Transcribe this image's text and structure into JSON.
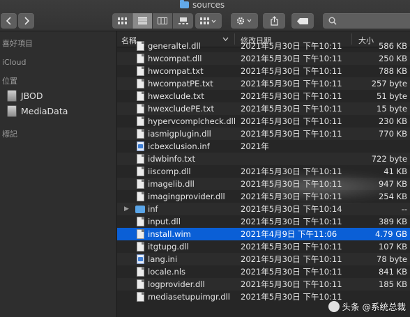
{
  "window": {
    "title": "sources"
  },
  "toolbar": {
    "back_icon": "chevron-left-icon",
    "forward_icon": "chevron-right-icon",
    "view_modes": [
      "icon-view",
      "list-view",
      "column-view",
      "gallery-view"
    ],
    "active_view": "list-view"
  },
  "sidebar": {
    "favorites_header": "喜好項目",
    "icloud_header": "iCloud",
    "locations_header": "位置",
    "devices": [
      {
        "label": "JBOD"
      },
      {
        "label": "MediaData"
      }
    ],
    "tags_header": "標記"
  },
  "columns": {
    "name": "名稱",
    "date": "修改日期",
    "size": "大小"
  },
  "files": [
    {
      "name": "generaltel.dll",
      "date": "2021年5月30日 下午10:11",
      "size": "586 KB",
      "kind": "doc"
    },
    {
      "name": "hwcompat.dll",
      "date": "2021年5月30日 下午10:11",
      "size": "250 KB",
      "kind": "doc"
    },
    {
      "name": "hwcompat.txt",
      "date": "2021年5月30日 下午10:11",
      "size": "788 KB",
      "kind": "doc"
    },
    {
      "name": "hwcompatPE.txt",
      "date": "2021年5月30日 下午10:11",
      "size": "257 byte",
      "kind": "doc"
    },
    {
      "name": "hwexclude.txt",
      "date": "2021年5月30日 下午10:11",
      "size": "51 byte",
      "kind": "doc"
    },
    {
      "name": "hwexcludePE.txt",
      "date": "2021年5月30日 下午10:11",
      "size": "15 byte",
      "kind": "doc"
    },
    {
      "name": "hypervcomplcheck.dll",
      "date": "2021年5月30日 下午10:11",
      "size": "230 KB",
      "kind": "doc"
    },
    {
      "name": "iasmigplugin.dll",
      "date": "2021年5月30日 下午10:11",
      "size": "770 KB",
      "kind": "doc"
    },
    {
      "name": "icbexclusion.inf",
      "date": "2021年",
      "size": "",
      "kind": "inf"
    },
    {
      "name": "idwbinfo.txt",
      "date": "",
      "size": "722 byte",
      "kind": "doc"
    },
    {
      "name": "iiscomp.dll",
      "date": "2021年5月30日 下午10:11",
      "size": "41 KB",
      "kind": "doc"
    },
    {
      "name": "imagelib.dll",
      "date": "2021年5月30日 下午10:11",
      "size": "947 KB",
      "kind": "doc"
    },
    {
      "name": "imagingprovider.dll",
      "date": "2021年5月30日 下午10:11",
      "size": "254 KB",
      "kind": "doc"
    },
    {
      "name": "inf",
      "date": "2021年5月30日 下午10:14",
      "size": "--",
      "kind": "folder"
    },
    {
      "name": "input.dll",
      "date": "2021年5月30日 下午10:11",
      "size": "389 KB",
      "kind": "doc"
    },
    {
      "name": "install.wim",
      "date": "2021年4月9日 下午11:06",
      "size": "4.79 GB",
      "kind": "doc",
      "selected": true
    },
    {
      "name": "itgtupg.dll",
      "date": "2021年5月30日 下午10:11",
      "size": "107 KB",
      "kind": "doc"
    },
    {
      "name": "lang.ini",
      "date": "2021年5月30日 下午10:11",
      "size": "78 byte",
      "kind": "inf"
    },
    {
      "name": "locale.nls",
      "date": "2021年5月30日 下午10:11",
      "size": "841 KB",
      "kind": "doc"
    },
    {
      "name": "logprovider.dll",
      "date": "2021年5月30日 下午10:11",
      "size": "185 KB",
      "kind": "doc"
    },
    {
      "name": "mediasetupuimgr.dll",
      "date": "2021年5月30日 下午10:11",
      "size": "",
      "kind": "doc"
    }
  ],
  "watermark": {
    "text": "头条 @系统总裁"
  }
}
